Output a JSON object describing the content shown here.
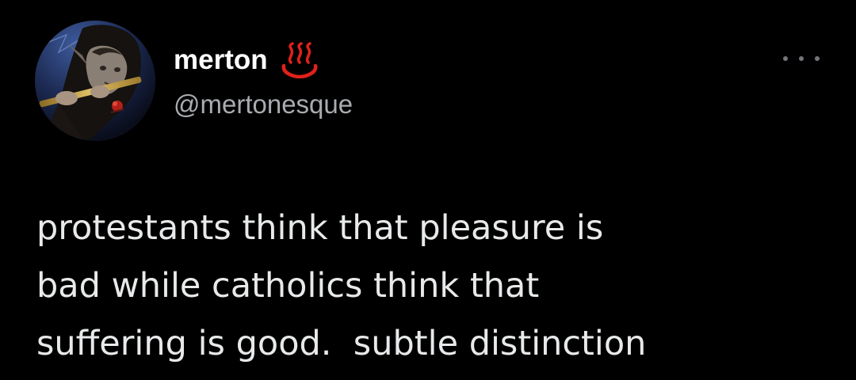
{
  "author": {
    "display_name": "merton",
    "handle": "@mertonesque",
    "avatar_icon": "avatar-flute-player",
    "badge_icon": "hot-springs-icon",
    "badge_color": "#e0211b"
  },
  "actions": {
    "more_icon": "more-options-icon"
  },
  "tweet": {
    "lines": [
      "protestants think that pleasure is",
      "bad while catholics think that",
      "suffering is good.  subtle distinction"
    ]
  },
  "colors": {
    "background": "#000000",
    "primary_text": "#e7e9ea",
    "secondary_text": "#a8acb0"
  }
}
